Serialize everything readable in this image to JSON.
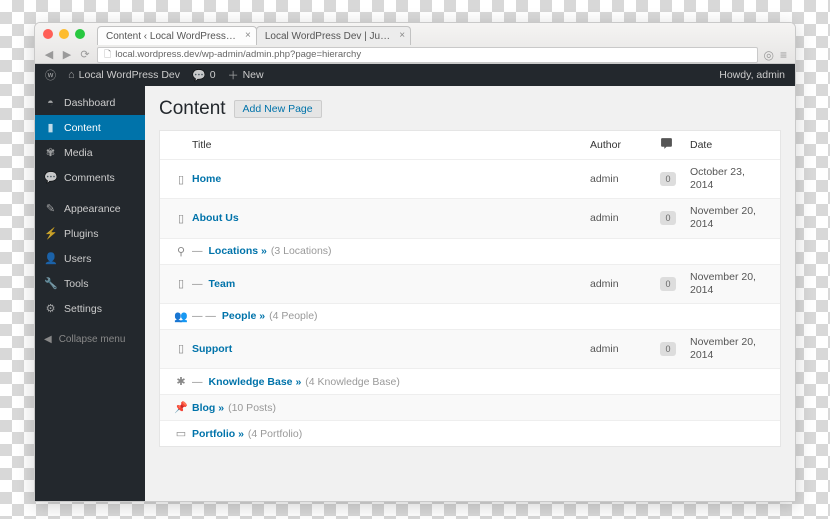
{
  "browser": {
    "tabs": [
      {
        "label": "Content ‹ Local WordPress…"
      },
      {
        "label": "Local WordPress Dev | Ju…"
      }
    ],
    "url": "local.wordpress.dev/wp-admin/admin.php?page=hierarchy"
  },
  "adminbar": {
    "site_name": "Local WordPress Dev",
    "comment_count": "0",
    "new_label": "New",
    "howdy": "Howdy, admin"
  },
  "sidebar": {
    "items": [
      {
        "icon": "dashboard",
        "label": "Dashboard"
      },
      {
        "icon": "folder",
        "label": "Content"
      },
      {
        "icon": "media",
        "label": "Media"
      },
      {
        "icon": "comment",
        "label": "Comments"
      },
      {
        "icon": "brush",
        "label": "Appearance"
      },
      {
        "icon": "plug",
        "label": "Plugins"
      },
      {
        "icon": "user",
        "label": "Users"
      },
      {
        "icon": "wrench",
        "label": "Tools"
      },
      {
        "icon": "gear",
        "label": "Settings"
      }
    ],
    "collapse": "Collapse menu"
  },
  "page": {
    "title": "Content",
    "add_new": "Add New Page",
    "columns": {
      "title": "Title",
      "author": "Author",
      "date": "Date"
    },
    "rows": [
      {
        "icon": "page",
        "indent": 0,
        "title": "Home",
        "arrow": false,
        "count": "",
        "author": "admin",
        "comments": "0",
        "date": "October 23, 2014"
      },
      {
        "icon": "page",
        "indent": 0,
        "title": "About Us",
        "arrow": false,
        "count": "",
        "author": "admin",
        "comments": "0",
        "date": "November 20, 2014"
      },
      {
        "icon": "pin",
        "indent": 1,
        "title": "Locations",
        "arrow": true,
        "count": "(3 Locations)",
        "author": "",
        "comments": "",
        "date": ""
      },
      {
        "icon": "page",
        "indent": 1,
        "title": "Team",
        "arrow": false,
        "count": "",
        "author": "admin",
        "comments": "0",
        "date": "November 20, 2014"
      },
      {
        "icon": "people",
        "indent": 2,
        "title": "People",
        "arrow": true,
        "count": "(4 People)",
        "author": "",
        "comments": "",
        "date": ""
      },
      {
        "icon": "page",
        "indent": 0,
        "title": "Support",
        "arrow": false,
        "count": "",
        "author": "admin",
        "comments": "0",
        "date": "November 20, 2014"
      },
      {
        "icon": "kb",
        "indent": 1,
        "title": "Knowledge Base",
        "arrow": true,
        "count": "(4 Knowledge Base)",
        "author": "",
        "comments": "",
        "date": ""
      },
      {
        "icon": "pushpin",
        "indent": 0,
        "title": "Blog",
        "arrow": true,
        "count": "(10 Posts)",
        "author": "",
        "comments": "",
        "date": ""
      },
      {
        "icon": "portfolio",
        "indent": 0,
        "title": "Portfolio",
        "arrow": true,
        "count": "(4 Portfolio)",
        "author": "",
        "comments": "",
        "date": ""
      }
    ]
  }
}
